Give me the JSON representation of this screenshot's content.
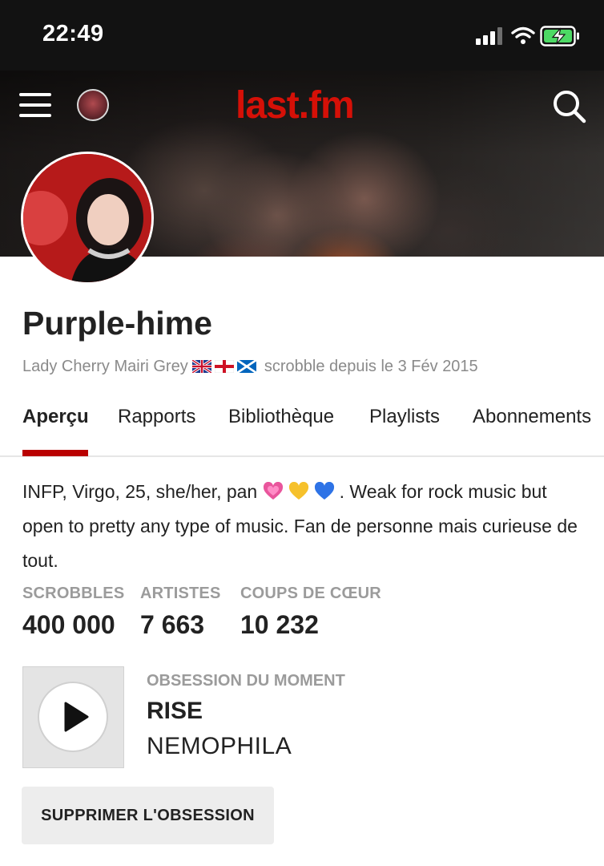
{
  "status_bar": {
    "time": "22:49",
    "icons": [
      "signal-icon",
      "wifi-icon",
      "battery-charging-icon"
    ]
  },
  "header": {
    "logo": "last.fm",
    "icons": [
      "menu-icon",
      "search-icon"
    ]
  },
  "profile": {
    "username": "Purple-hime",
    "real_name": "Lady Cherry Mairi Grey",
    "flags": [
      "uk-flag-icon",
      "england-flag-icon",
      "scotland-flag-icon"
    ],
    "since": "scrobble depuis le 3 Fév 2015"
  },
  "tabs": [
    {
      "label": "Aperçu",
      "active": true
    },
    {
      "label": "Rapports"
    },
    {
      "label": "Bibliothèque"
    },
    {
      "label": "Playlists"
    },
    {
      "label": "Abonnements"
    }
  ],
  "bio": {
    "part1": "INFP, Virgo, 25, she/her, pan ",
    "hearts": [
      "pink-heart-icon",
      "yellow-heart-icon",
      "blue-heart-icon"
    ],
    "part2": ". Weak for rock music but open to pretty any type of music. Fan de personne mais curieuse de tout."
  },
  "stats": [
    {
      "label": "SCROBBLES",
      "value": "400 000"
    },
    {
      "label": "ARTISTES",
      "value": "7 663"
    },
    {
      "label": "COUPS DE CŒUR",
      "value": "10 232"
    }
  ],
  "obsession": {
    "label": "OBSESSION DU MOMENT",
    "track": "RISE",
    "artist": "NEMOPHILA",
    "remove_label": "SUPPRIMER L'OBSESSION"
  },
  "colors": {
    "brand_red": "#d51007",
    "tab_indicator": "#b90000",
    "status_bar_bg": "#121212",
    "muted_text": "#9b9b9b"
  }
}
